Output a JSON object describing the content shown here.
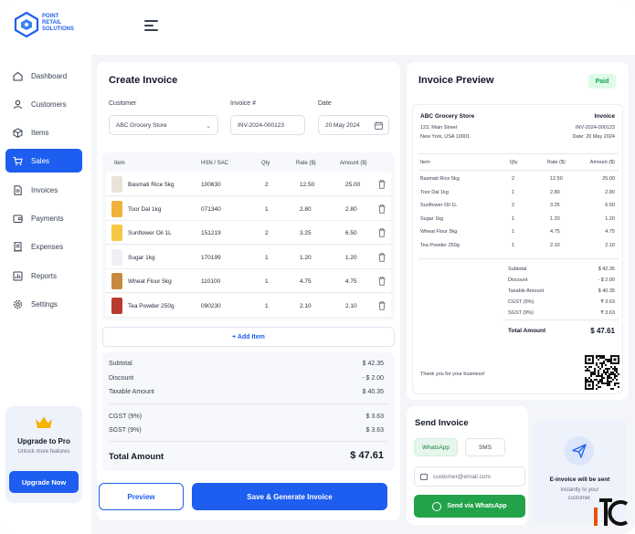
{
  "brand": {
    "name_line1": "POINT",
    "name_line2": "RETAIL",
    "name_line3": "SOLUTIONS",
    "accent": "#1d5ef0"
  },
  "sidebar": {
    "items": [
      {
        "label": "Dashboard",
        "icon": "home-icon"
      },
      {
        "label": "Customers",
        "icon": "user-icon"
      },
      {
        "label": "Items",
        "icon": "box-icon"
      },
      {
        "label": "Sales",
        "icon": "cart-icon",
        "active": true
      },
      {
        "label": "Invoices",
        "icon": "document-icon"
      },
      {
        "label": "Payments",
        "icon": "wallet-icon"
      },
      {
        "label": "Expenses",
        "icon": "receipt-icon"
      },
      {
        "label": "Reports",
        "icon": "chart-icon"
      },
      {
        "label": "Settings",
        "icon": "gear-icon"
      }
    ],
    "upgrade": {
      "title": "Upgrade to Pro",
      "subtitle": "Unlock more features",
      "button": "Upgrade Now"
    }
  },
  "create_invoice": {
    "title": "Create Invoice",
    "customer_label": "Customer",
    "customer_value": "ABC Grocery Store",
    "invoice_no_label": "Invoice #",
    "invoice_no_value": "INV-2024-000123",
    "date_label": "Date",
    "date_value": "20 May 2024",
    "columns": [
      "Item",
      "HSN / SAC",
      "Qty",
      "Rate ($)",
      "Amount ($)"
    ],
    "rows": [
      {
        "item": "Basmati Rice 5kg",
        "hsn": "100630",
        "qty": "2",
        "rate": "12.50",
        "amount": "25.00",
        "color": "#e9e4d6"
      },
      {
        "item": "Toor Dal 1kg",
        "hsn": "071340",
        "qty": "1",
        "rate": "2.80",
        "amount": "2.80",
        "color": "#f0b23b"
      },
      {
        "item": "Sunflower Oil 1L",
        "hsn": "151219",
        "qty": "2",
        "rate": "3.25",
        "amount": "6.50",
        "color": "#f5c842"
      },
      {
        "item": "Sugar 1kg",
        "hsn": "170199",
        "qty": "1",
        "rate": "1.20",
        "amount": "1.20",
        "color": "#eef0f3"
      },
      {
        "item": "Wheat Flour 5kg",
        "hsn": "110100",
        "qty": "1",
        "rate": "4.75",
        "amount": "4.75",
        "color": "#c7893f"
      },
      {
        "item": "Tea Powder 250g",
        "hsn": "090230",
        "qty": "1",
        "rate": "2.10",
        "amount": "2.10",
        "color": "#b73b2e"
      }
    ],
    "add_item": "+ Add Item",
    "summary": {
      "subtotal_label": "Subtotal",
      "subtotal": "$ 42.35",
      "discount_label": "Discount",
      "discount": "- $ 2.00",
      "taxable_label": "Taxable Amount",
      "taxable": "$ 40.35",
      "cgst_label": "CGST (9%)",
      "cgst": "$ 3.63",
      "sgst_label": "SGST (9%)",
      "sgst": "$ 3.63",
      "total_label": "Total Amount",
      "total": "$ 47.61"
    },
    "preview_button": "Preview",
    "generate_button": "Save & Generate Invoice"
  },
  "invoice_preview": {
    "title": "Invoice Preview",
    "status": "Paid",
    "store_name": "ABC Grocery Store",
    "address1": "123, Main Street",
    "address2": "New York, USA 10001",
    "doc_title": "Invoice",
    "doc_no": "INV-2024-000123",
    "doc_date": "Date: 20 May 2024",
    "columns": [
      "Item",
      "Qty",
      "Rate ($)",
      "Amount ($)"
    ],
    "rows": [
      {
        "item": "Basmati Rice 5kg",
        "qty": "2",
        "rate": "12.50",
        "amount": "25.00"
      },
      {
        "item": "Toor Dal 1kg",
        "qty": "1",
        "rate": "2.80",
        "amount": "2.80"
      },
      {
        "item": "Sunflower Oil 1L",
        "qty": "2",
        "rate": "3.25",
        "amount": "6.50"
      },
      {
        "item": "Sugar 1kg",
        "qty": "1",
        "rate": "1.20",
        "amount": "1.20"
      },
      {
        "item": "Wheat Flour 5kg",
        "qty": "1",
        "rate": "4.75",
        "amount": "4.75"
      },
      {
        "item": "Tea Powder 250g",
        "qty": "1",
        "rate": "2.10",
        "amount": "2.10"
      }
    ],
    "totals": [
      {
        "label": "Subtotal",
        "value": "$ 42.35"
      },
      {
        "label": "Discount",
        "value": "- $ 2.00"
      },
      {
        "label": "Taxable Amount",
        "value": "$ 40.35"
      },
      {
        "label": "CGST (9%)",
        "value": "₹ 3.63"
      },
      {
        "label": "SGST (9%)",
        "value": "₹ 3.63"
      }
    ],
    "total_label": "Total Amount",
    "total_value": "$ 47.61",
    "thanks": "Thank you for your business!"
  },
  "send_invoice": {
    "title": "Send Invoice",
    "whatsapp_tab": "WhatsApp",
    "sms_tab": "SMS",
    "email_value": "customer@email.com",
    "send_button": "Send via WhatsApp"
  },
  "einvoice": {
    "title": "E-invoice will be sent",
    "line1": "instantly to your",
    "line2": "customer."
  }
}
